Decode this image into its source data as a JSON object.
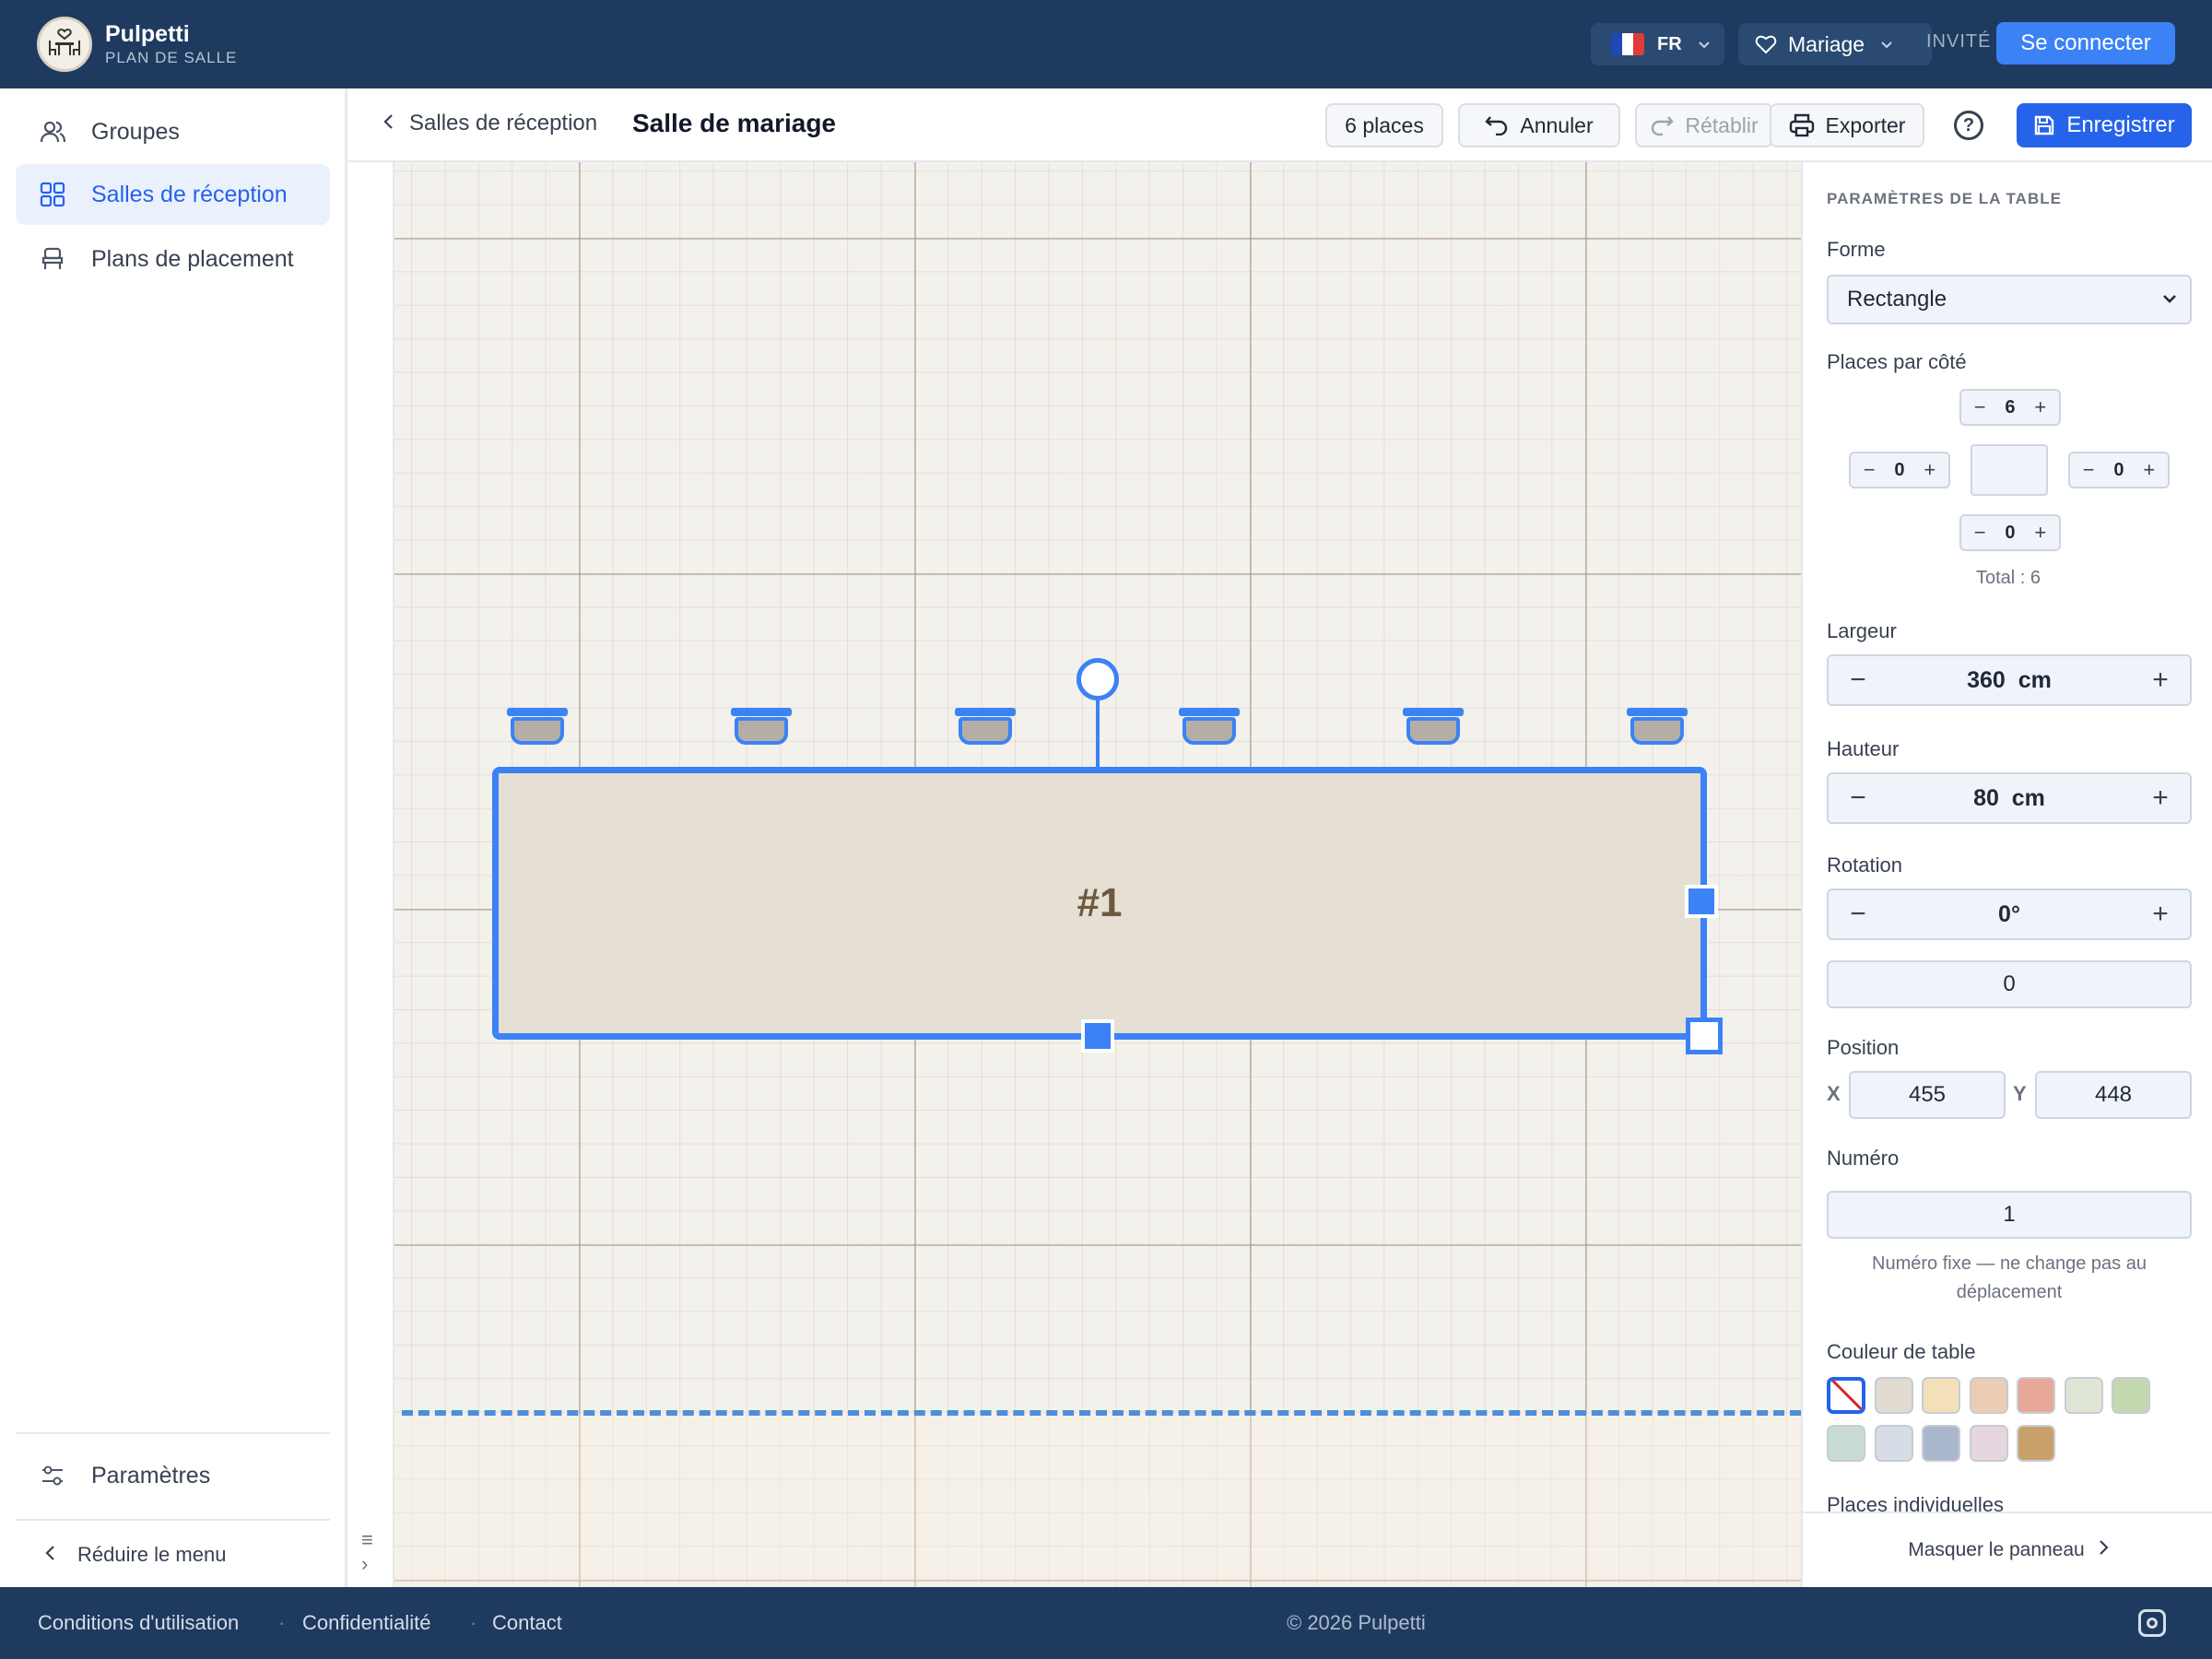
{
  "header": {
    "brand_name": "Pulpetti",
    "brand_sub": "PLAN DE SALLE",
    "lang_code": "FR",
    "event_label": "Mariage",
    "guest_label": "INVITÉ",
    "login_label": "Se connecter"
  },
  "sidebar": {
    "items": [
      {
        "label": "Groupes",
        "icon": "users-icon"
      },
      {
        "label": "Salles de réception",
        "icon": "grid-icon"
      },
      {
        "label": "Plans de placement",
        "icon": "chair-icon"
      }
    ],
    "settings_label": "Paramètres",
    "reduce_label": "Réduire le menu"
  },
  "toolbar": {
    "back_label": "Salles de réception",
    "title": "Salle de mariage",
    "places_label": "6 places",
    "undo_label": "Annuler",
    "redo_label": "Rétablir",
    "export_label": "Exporter",
    "save_label": "Enregistrer",
    "help_glyph": "?"
  },
  "canvas": {
    "table_label": "#1",
    "seat_count": 6
  },
  "panel": {
    "section_title": "PARAMÈTRES DE LA TABLE",
    "shape_label": "Forme",
    "shape_value": "Rectangle",
    "places_per_side_label": "Places par côté",
    "side_top": "6",
    "side_left": "0",
    "side_right": "0",
    "side_bottom": "0",
    "total": "Total : 6",
    "width_label": "Largeur",
    "width_value": "360  cm",
    "height_label": "Hauteur",
    "height_value": "80  cm",
    "rotation_label": "Rotation",
    "rotation_value": "0°",
    "rotation_input": "0",
    "position_label": "Position",
    "x_label": "X",
    "x_value": "455",
    "y_label": "Y",
    "y_value": "448",
    "number_label": "Numéro",
    "number_value": "1",
    "number_hint": "Numéro fixe — ne change pas au déplacement",
    "color_label": "Couleur de table",
    "colors": [
      "none",
      "#e2dbd2",
      "#f3e0b8",
      "#ebcdb3",
      "#e8a898",
      "#dfe6d6",
      "#c4d8b0",
      "#c8dcd4",
      "#d6dde6",
      "#a8b7cc",
      "#e6d6df",
      "#c9a06a"
    ],
    "individual_label": "Places individuelles",
    "hide_label": "Masquer le panneau"
  },
  "footer": {
    "terms": "Conditions d'utilisation",
    "privacy": "Confidentialité",
    "contact": "Contact",
    "copyright": "© 2026 Pulpetti"
  }
}
